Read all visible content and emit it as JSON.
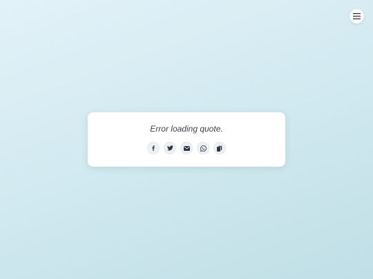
{
  "page": {
    "background_colors": [
      "#e2f2f8",
      "#d3eaf1",
      "#c0dfe6"
    ]
  },
  "menu": {
    "icon": "hamburger-menu-icon"
  },
  "quote_card": {
    "text": "Error loading quote.",
    "share_buttons": [
      {
        "icon": "facebook-icon"
      },
      {
        "icon": "twitter-icon"
      },
      {
        "icon": "email-icon"
      },
      {
        "icon": "whatsapp-icon"
      },
      {
        "icon": "copy-icon"
      }
    ]
  },
  "colors": {
    "text": "#3b4250",
    "icon": "#2f3642",
    "button_bg": "#eef1f4"
  }
}
